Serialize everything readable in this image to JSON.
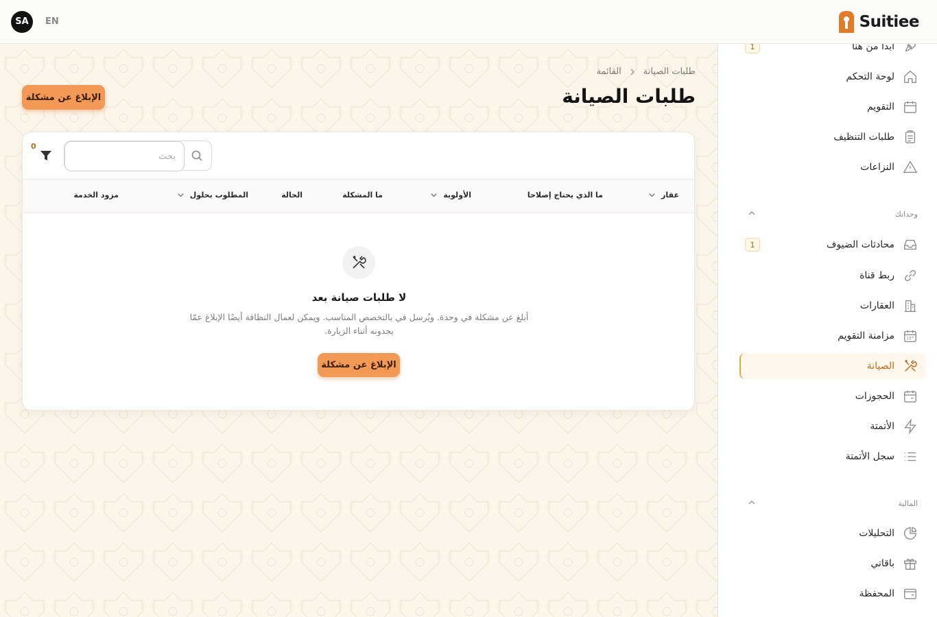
{
  "topbar": {
    "avatar": "SA",
    "lang": "EN",
    "brand": "Suitiee"
  },
  "sidebar": {
    "items_top": [
      {
        "label": "ابدأ من هنا",
        "icon": "rocket-icon",
        "badge": "1"
      },
      {
        "label": "لوحة التحكم",
        "icon": "home-icon"
      },
      {
        "label": "التقويم",
        "icon": "calendar-icon"
      },
      {
        "label": "طلبات التنظيف",
        "icon": "clipboard-icon"
      },
      {
        "label": "النزاعات",
        "icon": "warning-icon"
      }
    ],
    "section_units": "وحداتك",
    "items_units": [
      {
        "label": "محادثات الضيوف",
        "icon": "inbox-icon",
        "badge": "1"
      },
      {
        "label": "ربط قناة",
        "icon": "link-icon"
      },
      {
        "label": "العقارات",
        "icon": "building-icon"
      },
      {
        "label": "مزامنة التقويم",
        "icon": "calendar-sync-icon"
      },
      {
        "label": "الصيانة",
        "icon": "tools-icon",
        "active": true
      },
      {
        "label": "الحجوزات",
        "icon": "calendar-check-icon"
      },
      {
        "label": "الأتمتة",
        "icon": "bolt-icon"
      },
      {
        "label": "سجل الأتمتة",
        "icon": "list-icon"
      }
    ],
    "section_finance": "المالية",
    "items_finance": [
      {
        "label": "التحليلات",
        "icon": "pie-chart-icon"
      },
      {
        "label": "باقاتي",
        "icon": "gift-icon"
      },
      {
        "label": "المحفظة",
        "icon": "wallet-icon"
      }
    ]
  },
  "main": {
    "breadcrumb": {
      "root": "القائمة",
      "current": "طلبات الصيانة"
    },
    "title": "طلبات الصيانة",
    "report_button": "الإبلاغ عن مشكلة",
    "filter_count": "0",
    "search_placeholder": "بحث",
    "columns": [
      "عقار",
      "ما الذي يحتاج إصلاحا",
      "الأولوية",
      "ما المشكلة",
      "الحالة",
      "المطلوب بحلول",
      "مزود الخدمة"
    ],
    "empty": {
      "title": "لا طلبات صيانة بعد",
      "description": "أبلغ عن مشكلة في وحدة. ويُرسل في بالتخصص المناسب. ويمكن لعمال النظافة أيضًا الإبلاغ عمّا يجدونه أثناء الزيارة.",
      "button": "الإبلاغ عن مشكلة"
    }
  },
  "colors": {
    "accent": "#f29a55",
    "active_text": "#c26a1c",
    "background": "#fbf5ea"
  }
}
